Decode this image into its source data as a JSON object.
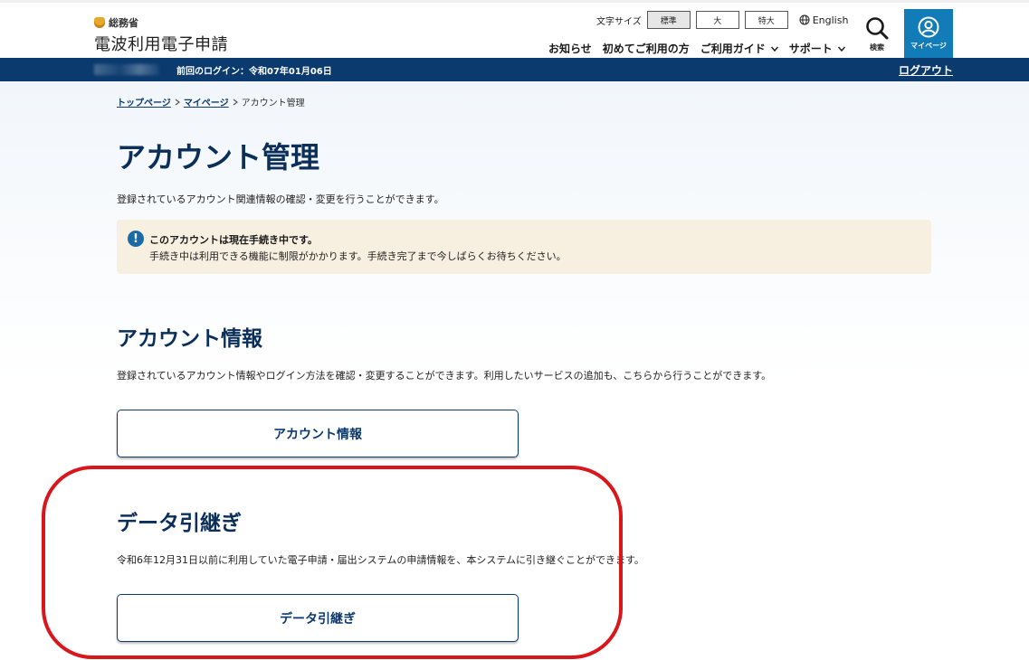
{
  "header": {
    "ministry": "総務省",
    "site_title": "電波利用電子申請",
    "font_size_label": "文字サイズ",
    "font_size_options": [
      "標準",
      "大",
      "特大"
    ],
    "language_label": "English",
    "nav": [
      "お知らせ",
      "初めてご利用の方",
      "ご利用ガイド",
      "サポート"
    ],
    "search_label": "検索",
    "mypage_label": "マイページ"
  },
  "userbar": {
    "last_login": "前回のログイン：令和07年01月06日",
    "logout": "ログアウト"
  },
  "breadcrumb": {
    "items": [
      "トップページ",
      "マイページ",
      "アカウント管理"
    ]
  },
  "page": {
    "title": "アカウント管理",
    "description": "登録されているアカウント関連情報の確認・変更を行うことができます。"
  },
  "notice": {
    "title": "このアカウントは現在手続き中です。",
    "body": "手続き中は利用できる機能に制限がかかります。手続き完了まで今しばらくお待ちください。"
  },
  "sections": [
    {
      "title": "アカウント情報",
      "description": "登録されているアカウント情報やログイン方法を確認・変更することができます。利用したいサービスの追加も、こちらから行うことができます。",
      "button": "アカウント情報"
    },
    {
      "title": "データ引継ぎ",
      "description": "令和6年12月31日以前に利用していた電子申請・届出システムの申請情報を、本システムに引き継ぐことができます。",
      "button": "データ引継ぎ"
    }
  ],
  "colors": {
    "brand_navy": "#0b3a6e",
    "mypage_blue": "#127cb8",
    "notice_bg": "#f7efe0",
    "highlight_red": "#d9161c"
  }
}
